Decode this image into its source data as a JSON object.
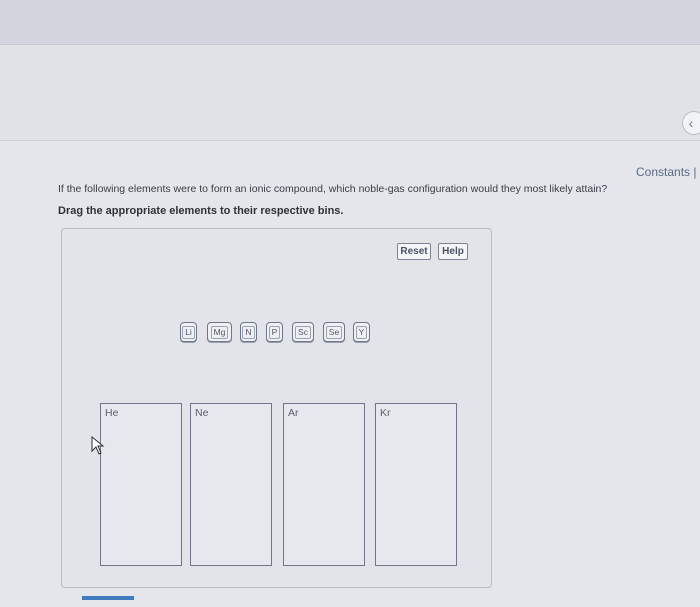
{
  "header": {
    "constants_link": "Constants | F",
    "collapse_icon": "chevron-left-icon"
  },
  "question": {
    "text": "If the following elements were to form an ionic compound, which noble-gas configuration would they most likely attain?",
    "instruction": "Drag the appropriate elements to their respective bins."
  },
  "controls": {
    "reset_label": "Reset",
    "help_label": "Help"
  },
  "elements": [
    "Li",
    "Mg",
    "N",
    "P",
    "Sc",
    "Se",
    "Y"
  ],
  "bins": [
    "He",
    "Ne",
    "Ar",
    "Kr"
  ],
  "colors": {
    "accent": "#3f7bbd",
    "link": "#5b6a86"
  }
}
